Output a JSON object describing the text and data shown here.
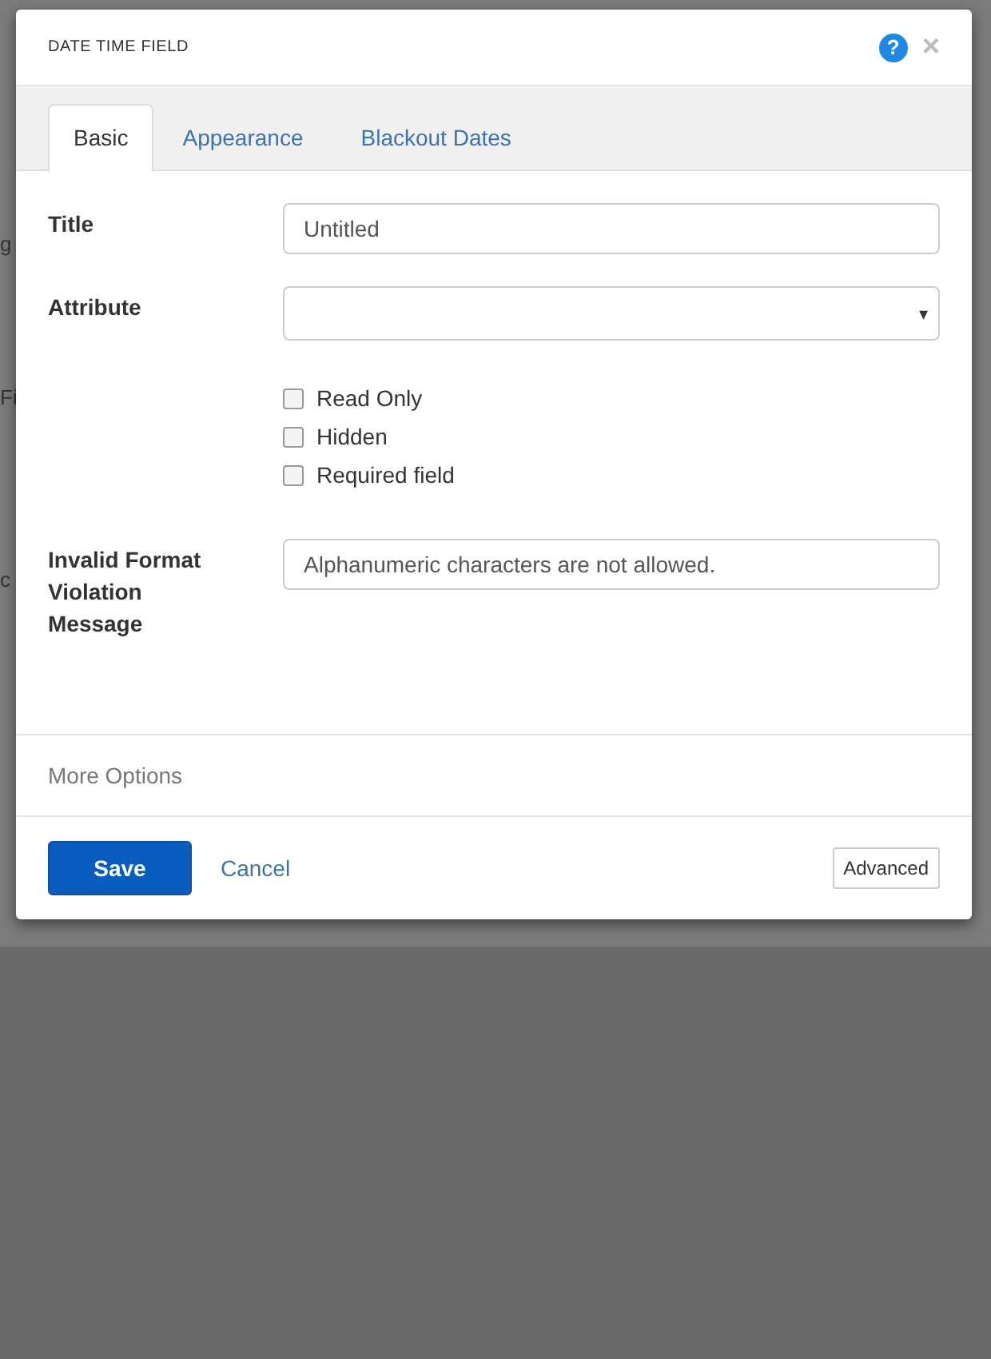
{
  "background_page": {
    "fragments": [
      "g",
      "Fi",
      "c"
    ]
  },
  "dialog": {
    "title": "DATE TIME FIELD",
    "help_icon": "?",
    "close_icon": "×"
  },
  "tabs": [
    {
      "label": "Basic",
      "selected": true
    },
    {
      "label": "Appearance",
      "selected": false
    },
    {
      "label": "Blackout Dates",
      "selected": false
    }
  ],
  "form": {
    "title": {
      "label": "Title",
      "value": "Untitled"
    },
    "attribute": {
      "label": "Attribute",
      "caret": "▾"
    },
    "options": [
      {
        "label": "Read Only",
        "checked": false
      },
      {
        "label": "Hidden",
        "checked": false
      },
      {
        "label": "Required field",
        "checked": false
      }
    ],
    "invalid_format": {
      "label": "Invalid Format Violation Message",
      "value": "Alphanumeric characters are not allowed."
    }
  },
  "more_options": "More Options",
  "footer": {
    "save": "Save",
    "cancel": "Cancel",
    "advanced": "Advanced"
  }
}
